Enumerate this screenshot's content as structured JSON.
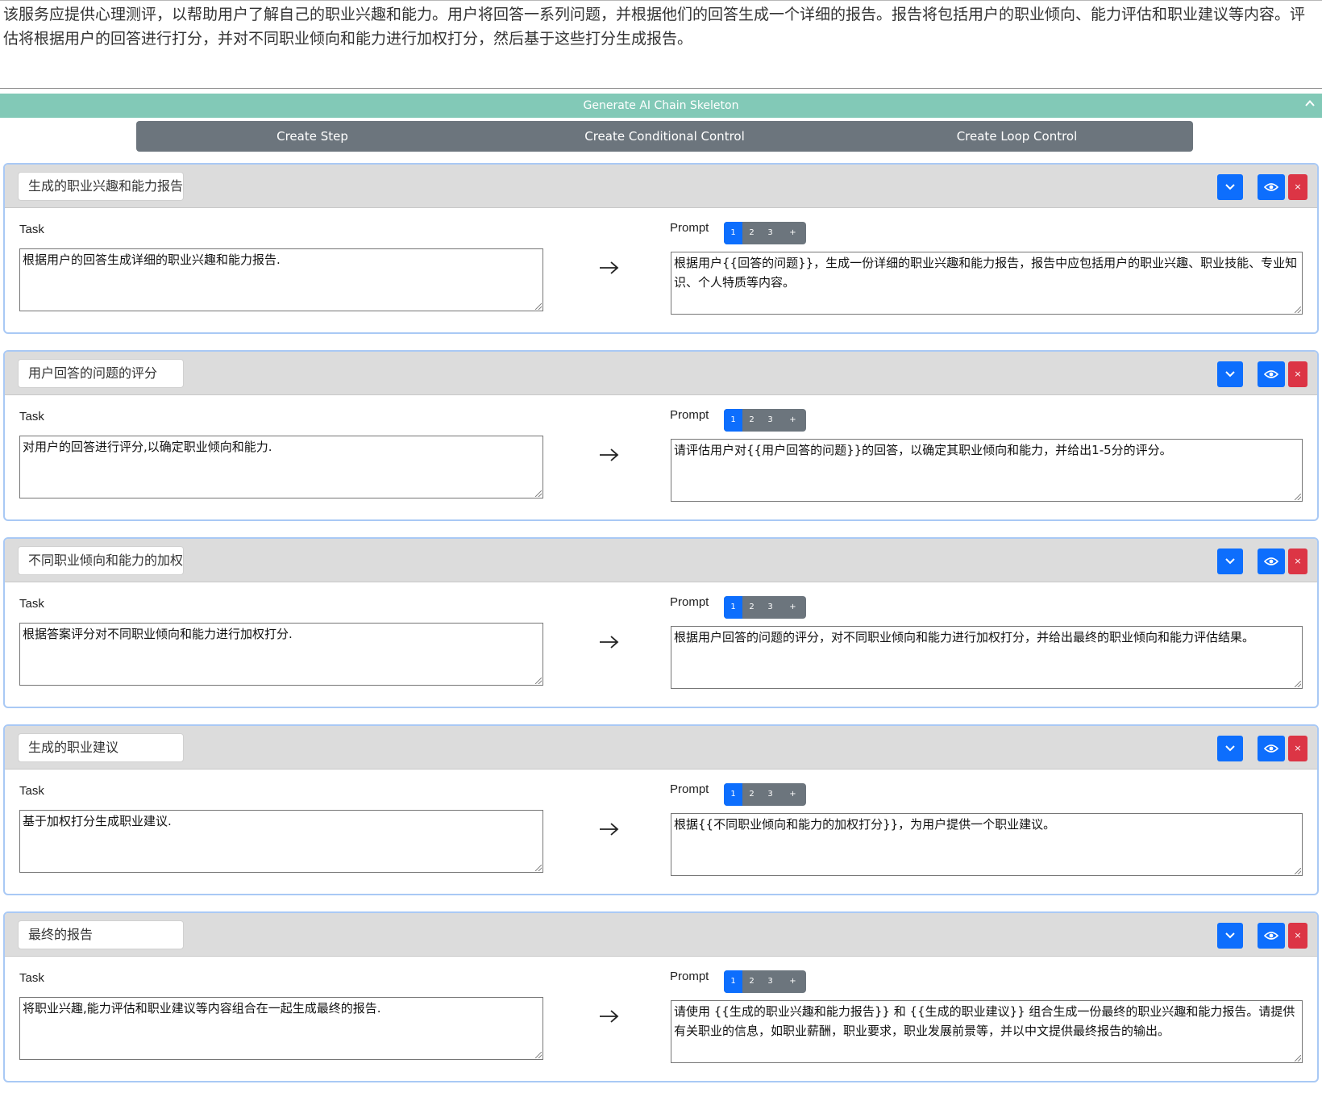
{
  "description": "该服务应提供心理测评，以帮助用户了解自己的职业兴趣和能力。用户将回答一系列问题，并根据他们的回答生成一个详细的报告。报告将包括用户的职业倾向、能力评估和职业建议等内容。评估将根据用户的回答进行打分，并对不同职业倾向和能力进行加权打分，然后基于这些打分生成报告。",
  "generate_bar": {
    "label": "Generate AI Chain Skeleton",
    "icon": "chevron-up-icon"
  },
  "controls": {
    "create_step": "Create Step",
    "create_conditional": "Create Conditional Control",
    "create_loop": "Create Loop Control"
  },
  "labels": {
    "task": "Task",
    "prompt": "Prompt"
  },
  "pagination": [
    "1",
    "2",
    "3",
    "+"
  ],
  "colors": {
    "accent": "#0d6efd",
    "danger": "#dc3545",
    "teal": "#82c9b7",
    "secondary": "#6c757d"
  },
  "steps": [
    {
      "name": "生成的职业兴趣和能力报告",
      "task": "根据用户的回答生成详细的职业兴趣和能力报告.",
      "prompt": "根据用户{{回答的问题}}，生成一份详细的职业兴趣和能力报告，报告中应包括用户的职业兴趣、职业技能、专业知识、个人特质等内容。"
    },
    {
      "name": "用户回答的问题的评分",
      "task": "对用户的回答进行评分,以确定职业倾向和能力.",
      "prompt": "请评估用户对{{用户回答的问题}}的回答，以确定其职业倾向和能力，并给出1-5分的评分。"
    },
    {
      "name": "不同职业倾向和能力的加权打分",
      "task": "根据答案评分对不同职业倾向和能力进行加权打分.",
      "prompt": "根据用户回答的问题的评分，对不同职业倾向和能力进行加权打分，并给出最终的职业倾向和能力评估结果。"
    },
    {
      "name": "生成的职业建议",
      "task": "基于加权打分生成职业建议.",
      "prompt": "根据{{不同职业倾向和能力的加权打分}}，为用户提供一个职业建议。"
    },
    {
      "name": "最终的报告",
      "task": "将职业兴趣,能力评估和职业建议等内容组合在一起生成最终的报告.",
      "prompt": "请使用 {{生成的职业兴趣和能力报告}} 和 {{生成的职业建议}} 组合生成一份最终的职业兴趣和能力报告。请提供有关职业的信息，如职业薪酬，职业要求，职业发展前景等，并以中文提供最终报告的输出。"
    }
  ]
}
